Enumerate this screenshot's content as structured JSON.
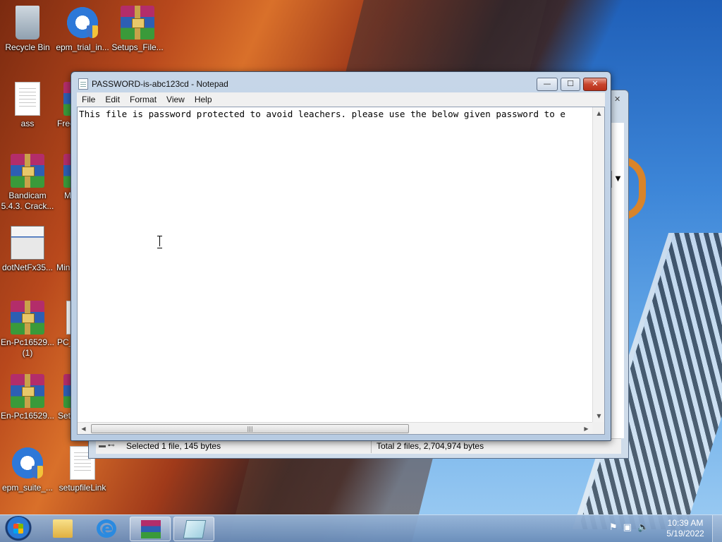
{
  "desktop": {
    "icons": [
      {
        "label": "Recycle Bin",
        "icon": "recycle-bin-icon"
      },
      {
        "label": "epm_trial_in...",
        "icon": "epm-installer-icon"
      },
      {
        "label": "Setups_File...",
        "icon": "winrar-archive-icon"
      },
      {
        "label": "ass",
        "icon": "text-file-icon"
      },
      {
        "label": "Free",
        "icon": "winrar-archive-icon"
      },
      {
        "label": "Bandicam 5.4.3. Crack...",
        "icon": "winrar-archive-icon"
      },
      {
        "label": "M",
        "icon": "winrar-archive-icon"
      },
      {
        "label": "dotNetFx35...",
        "icon": "installer-icon"
      },
      {
        "label": "Min",
        "icon": "winrar-archive-icon"
      },
      {
        "label": "En-Pc16529... (1)",
        "icon": "winrar-archive-icon"
      },
      {
        "label": "PC_",
        "icon": "text-file-icon"
      },
      {
        "label": "En-Pc16529...",
        "icon": "winrar-archive-icon"
      },
      {
        "label": "Set",
        "icon": "winrar-archive-icon"
      },
      {
        "label": "epm_suite_...",
        "icon": "epm-installer-icon"
      },
      {
        "label": "setupfileLink",
        "icon": "text-file-icon"
      }
    ]
  },
  "explorer_window": {
    "status_selected": "Selected 1 file, 145 bytes",
    "status_total": "Total 2 files, 2,704,974 bytes"
  },
  "notepad": {
    "title": "PASSWORD-is-abc123cd - Notepad",
    "menu": [
      "File",
      "Edit",
      "Format",
      "View",
      "Help"
    ],
    "content": "This file is password protected to avoid leachers. please use the below given password to e",
    "buttons": {
      "minimize": "—",
      "maximize": "☐",
      "close": "✕"
    }
  },
  "taskbar": {
    "items": [
      "windows-explorer",
      "internet-explorer",
      "winrar",
      "notepad"
    ],
    "active": "winrar",
    "clock_time": "10:39 AM",
    "clock_date": "5/19/2022"
  }
}
